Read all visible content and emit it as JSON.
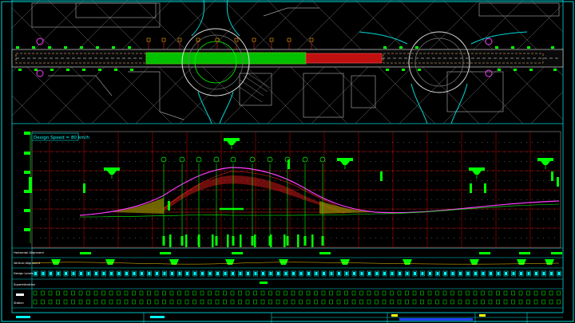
{
  "drawing": {
    "design_speed_label": "Design Speed = 80 km/h",
    "row_labels": [
      "Horizontal Alignment",
      "Vertical Alignment",
      "Design Levels",
      "Superelevation",
      "Station"
    ],
    "background_color": "#000000",
    "frame_color": "#00d7d7",
    "grid_color": "#b00000",
    "road_green": "#00ff00",
    "road_red": "#ff2020",
    "profile_magenta": "#ff3cff",
    "profile_yellow": "#e0d000"
  }
}
